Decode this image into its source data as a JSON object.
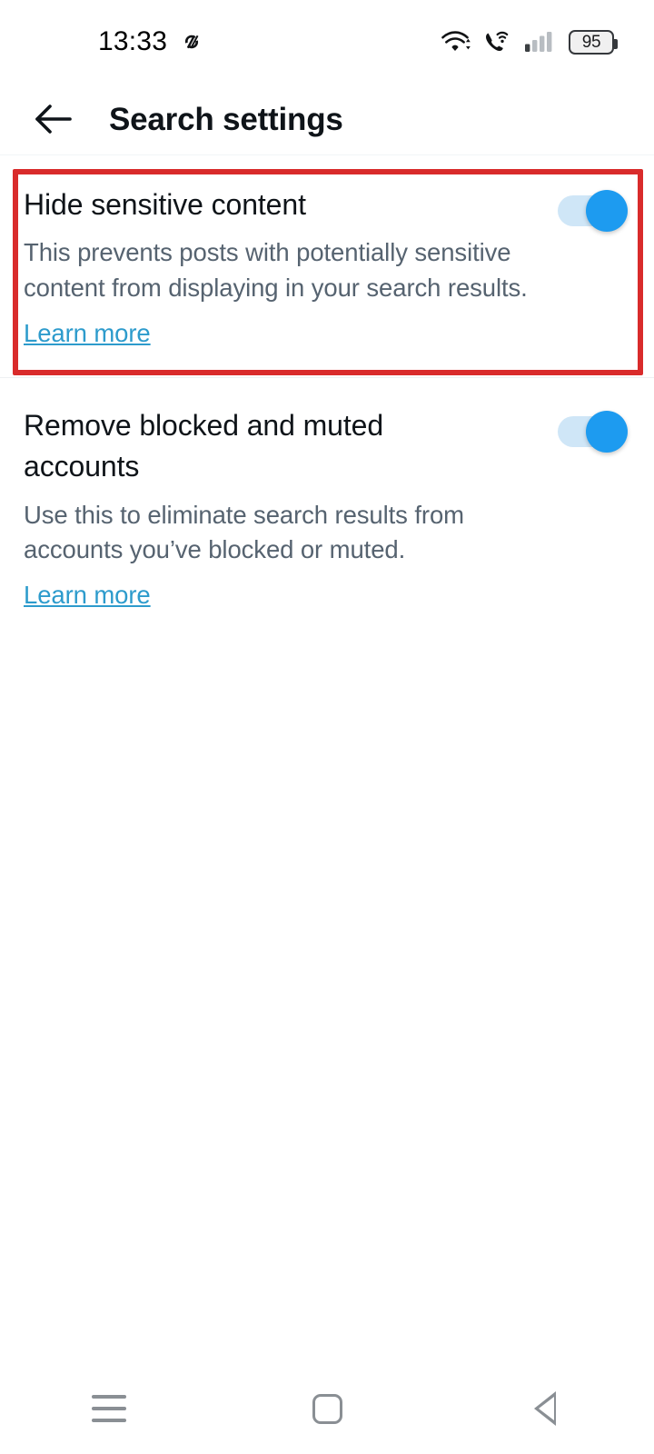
{
  "status_bar": {
    "clock": "13:33",
    "notification_icon": "app-notification-icon",
    "wifi_icon": "wifi-icon",
    "wifi_calling_icon": "wifi-calling-icon",
    "cellular_icon": "cellular-signal-icon",
    "battery_level": "95",
    "battery_icon": "battery-icon"
  },
  "header": {
    "back_icon": "back-arrow-icon",
    "title": "Search settings"
  },
  "settings": [
    {
      "title": "Hide sensitive content",
      "description": "This prevents posts with potentially sensitive content from displaying in your search results.",
      "link_label": "Learn more",
      "toggle_state": "on"
    },
    {
      "title": "Remove blocked and muted accounts",
      "description": "Use this to eliminate search results from accounts you’ve blocked or muted.",
      "link_label": "Learn more",
      "toggle_state": "on"
    }
  ],
  "annotation": {
    "highlight_color": "#d92b2b",
    "target": "Hide sensitive content"
  },
  "nav_bar": {
    "recents_icon": "recents-menu-icon",
    "home_icon": "home-square-icon",
    "back_icon": "back-triangle-icon"
  },
  "colors": {
    "accent_blue": "#1d9bf0",
    "link_blue": "#2d9bcc",
    "primary_text": "#0f1419",
    "secondary_text": "#566370",
    "background": "#ffffff"
  }
}
